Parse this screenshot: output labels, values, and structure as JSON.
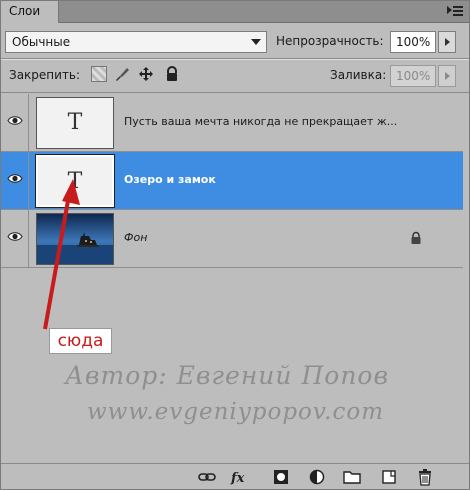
{
  "panel": {
    "tab_label": "Слои"
  },
  "blend": {
    "mode": "Обычные",
    "opacity_label": "Непрозрачность:",
    "opacity_value": "100%"
  },
  "lock": {
    "label": "Закрепить:",
    "fill_label": "Заливка:",
    "fill_value": "100%"
  },
  "layers": [
    {
      "name": "Пусть ваша мечта никогда не прекращает ж...",
      "thumb": "T",
      "kind": "text",
      "selected": false,
      "visible": true
    },
    {
      "name": "Озеро и замок",
      "thumb": "T",
      "kind": "text",
      "selected": true,
      "visible": true
    },
    {
      "name": "Фон",
      "kind": "image",
      "selected": false,
      "visible": true,
      "locked": true
    }
  ],
  "annotation": {
    "label": "сюда"
  },
  "watermark": {
    "line1": "Автор: Евгений Попов",
    "line2": "www.evgeniypopov.com"
  },
  "toolbar": {
    "fx_label": "fx"
  },
  "colors": {
    "selection": "#3f8de3",
    "panel_bg": "#bdbdbd",
    "annotation_red": "#c81b1b"
  }
}
